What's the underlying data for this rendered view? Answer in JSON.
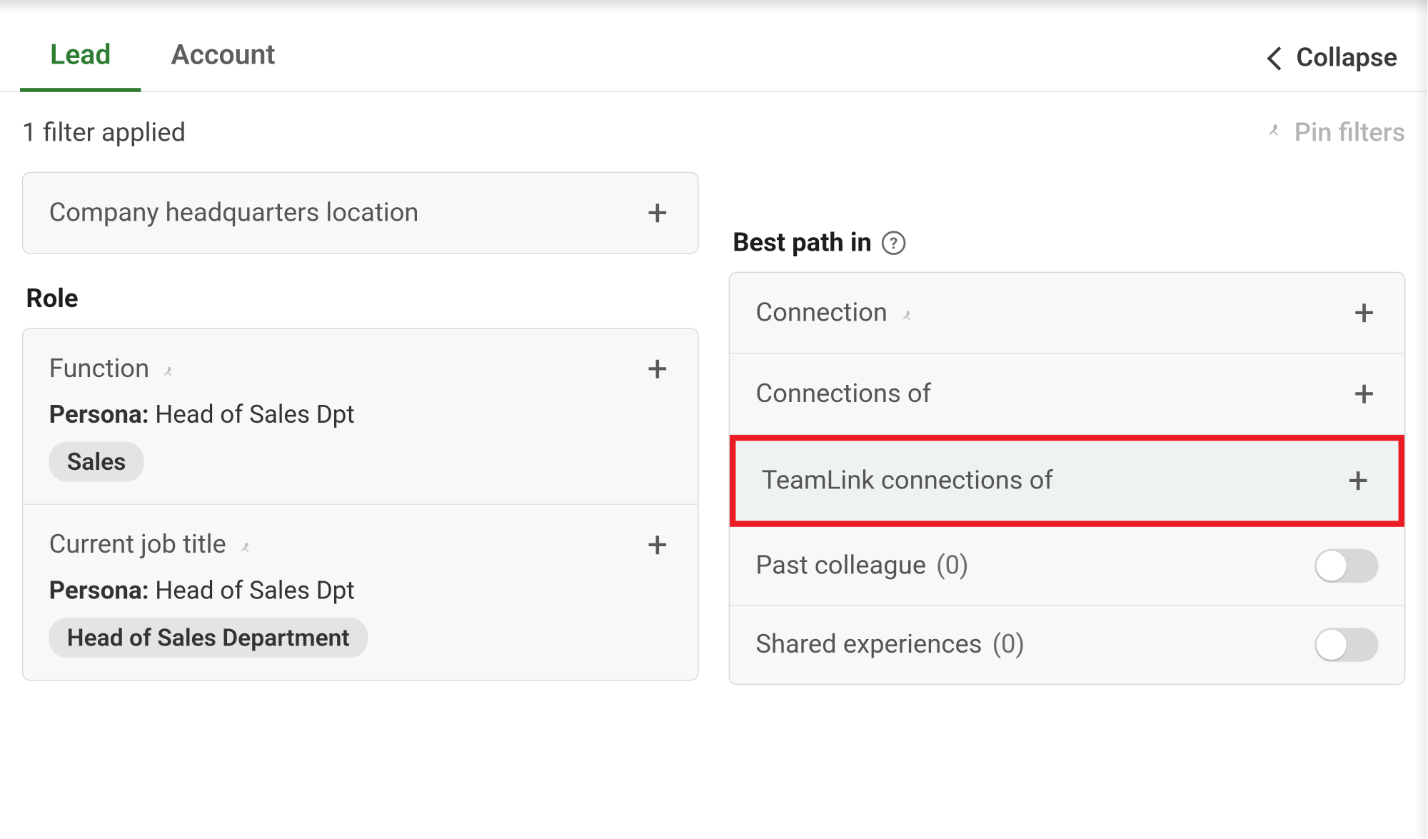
{
  "tabs": {
    "lead": "Lead",
    "account": "Account"
  },
  "collapse_label": "Collapse",
  "filters_applied_text": "1 filter applied",
  "pin_filters_label": "Pin filters",
  "left": {
    "company_hq": "Company headquarters location",
    "role_section": "Role",
    "function_label": "Function",
    "function_persona_label": "Persona:",
    "function_persona_value": "Head of Sales Dpt",
    "function_chip": "Sales",
    "jobtitle_label": "Current job title",
    "jobtitle_persona_label": "Persona:",
    "jobtitle_persona_value": "Head of Sales Dpt",
    "jobtitle_chip": "Head of Sales Department"
  },
  "right": {
    "section": "Best path in",
    "connection": "Connection",
    "connections_of": "Connections of",
    "teamlink": "TeamLink connections of",
    "past_colleague": "Past colleague",
    "past_colleague_count": "(0)",
    "shared_exp": "Shared experiences",
    "shared_exp_count": "(0)"
  }
}
